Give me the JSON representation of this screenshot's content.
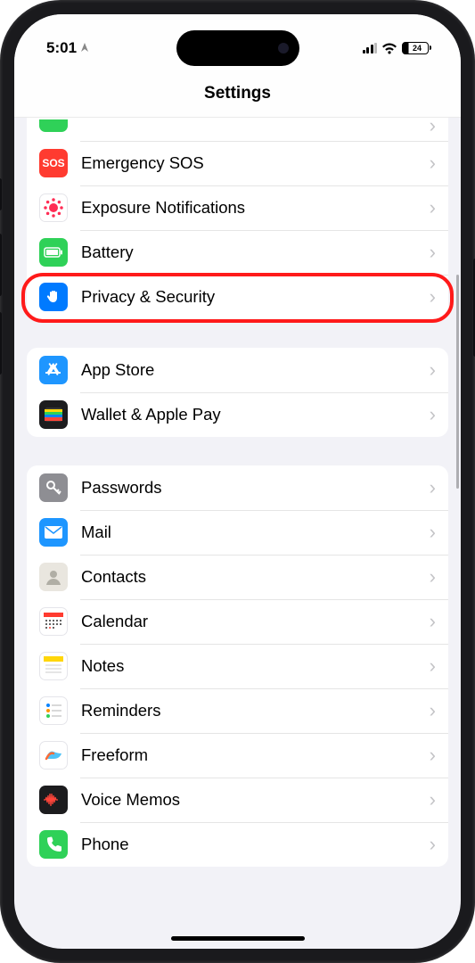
{
  "status": {
    "time": "5:01",
    "battery_pct": "24"
  },
  "header": {
    "title": "Settings"
  },
  "groups": [
    {
      "cut_top": true,
      "items": [
        {
          "id": "partial-prev",
          "label": "",
          "icon": "green-partial",
          "partial": true
        },
        {
          "id": "emergency-sos",
          "label": "Emergency SOS",
          "icon": "sos"
        },
        {
          "id": "exposure",
          "label": "Exposure Notifications",
          "icon": "exposure"
        },
        {
          "id": "battery",
          "label": "Battery",
          "icon": "battery"
        },
        {
          "id": "privacy",
          "label": "Privacy & Security",
          "icon": "hand",
          "highlighted": true
        }
      ]
    },
    {
      "items": [
        {
          "id": "app-store",
          "label": "App Store",
          "icon": "appstore"
        },
        {
          "id": "wallet",
          "label": "Wallet & Apple Pay",
          "icon": "wallet"
        }
      ]
    },
    {
      "items": [
        {
          "id": "passwords",
          "label": "Passwords",
          "icon": "key"
        },
        {
          "id": "mail",
          "label": "Mail",
          "icon": "mail"
        },
        {
          "id": "contacts",
          "label": "Contacts",
          "icon": "contacts"
        },
        {
          "id": "calendar",
          "label": "Calendar",
          "icon": "calendar"
        },
        {
          "id": "notes",
          "label": "Notes",
          "icon": "notes"
        },
        {
          "id": "reminders",
          "label": "Reminders",
          "icon": "reminders"
        },
        {
          "id": "freeform",
          "label": "Freeform",
          "icon": "freeform"
        },
        {
          "id": "voice-memos",
          "label": "Voice Memos",
          "icon": "voicememos"
        },
        {
          "id": "phone",
          "label": "Phone",
          "icon": "phone"
        }
      ]
    }
  ]
}
